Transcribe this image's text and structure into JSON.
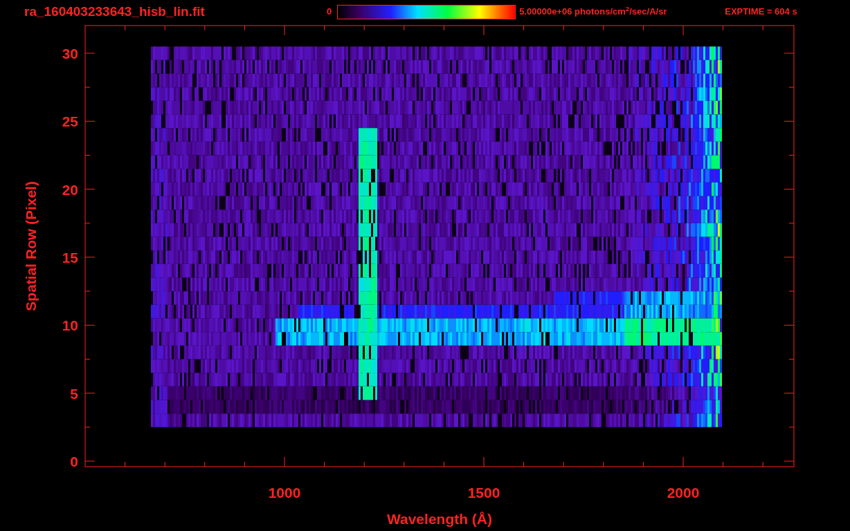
{
  "title": "ra_160403233643_hisb_lin.fit",
  "colorbar": {
    "min_label": "0",
    "max_label": "5.00000e+06 photons/cm$^{2}$/sec/A/sr"
  },
  "exposure": "EXPTIME = 604 s",
  "y_axis": {
    "label": "Spatial Row (Pixel)",
    "ticks": [
      "30",
      "25",
      "20",
      "15",
      "10",
      "5",
      "0"
    ]
  },
  "x_axis": {
    "label": "Wavelength (Å)",
    "ticks": [
      "1000",
      "1500",
      "2000"
    ]
  }
}
